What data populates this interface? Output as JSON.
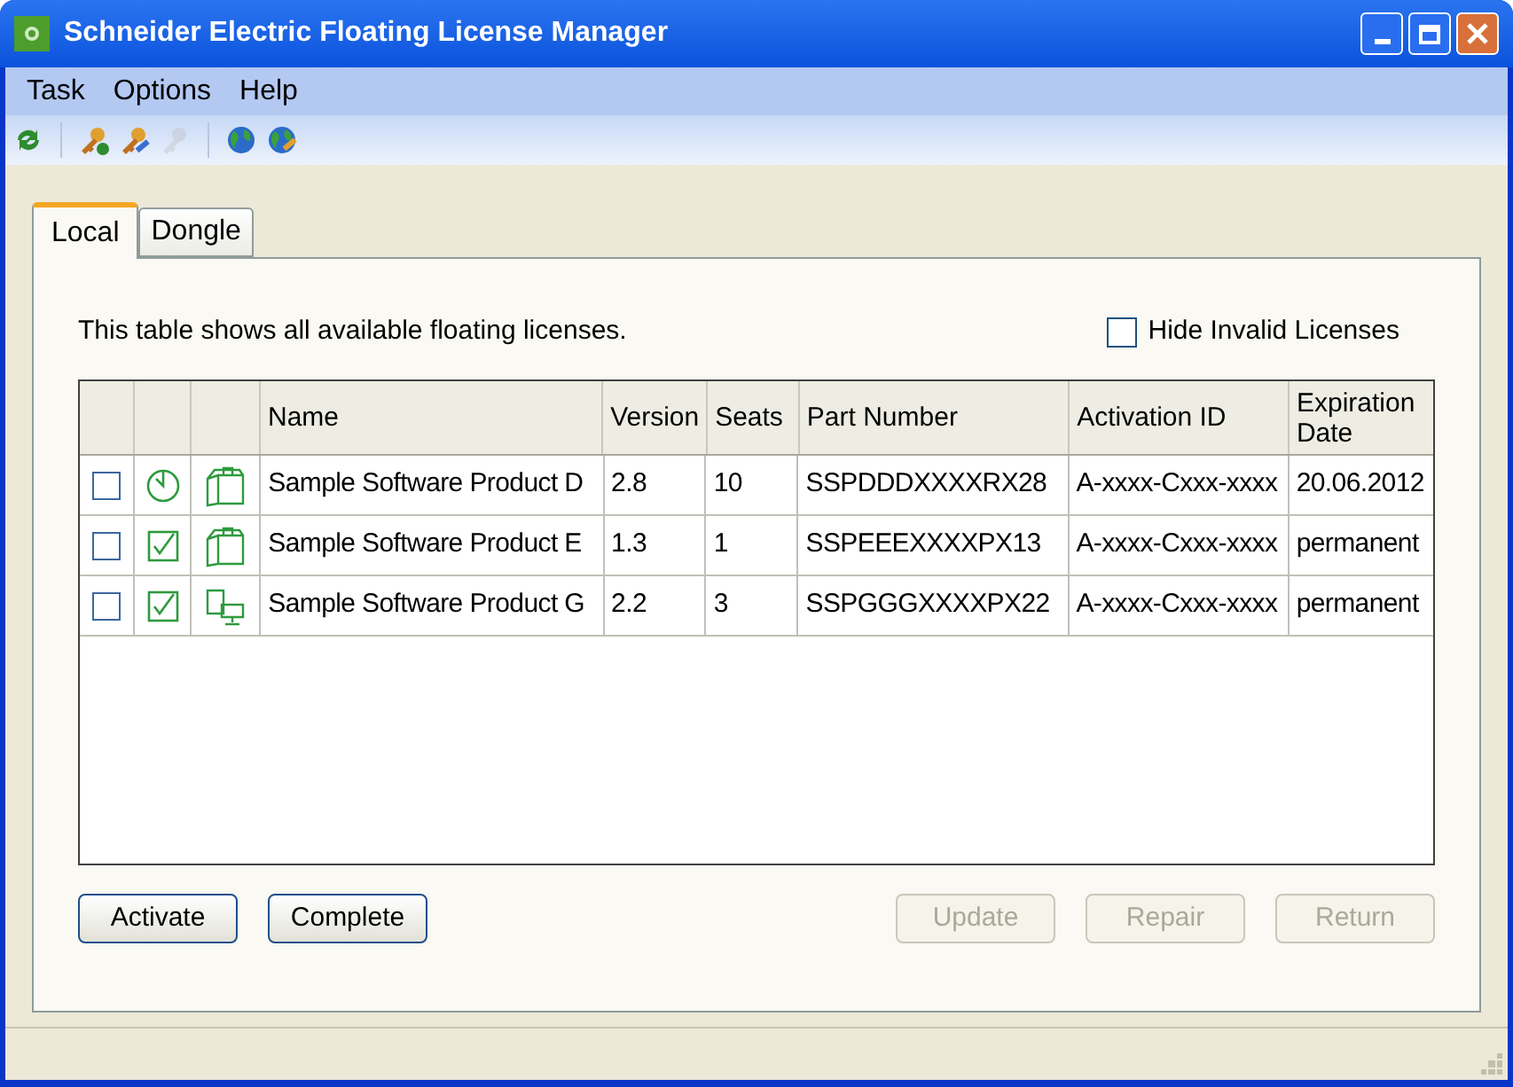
{
  "window": {
    "title": "Schneider Electric Floating License Manager"
  },
  "menu": [
    "Task",
    "Options",
    "Help"
  ],
  "toolbar": [
    {
      "kind": "refresh",
      "disabled": false
    },
    {
      "kind": "sep"
    },
    {
      "kind": "add",
      "disabled": false
    },
    {
      "kind": "edit",
      "disabled": false
    },
    {
      "kind": "remove",
      "disabled": true
    },
    {
      "kind": "sep"
    },
    {
      "kind": "globe",
      "disabled": false
    },
    {
      "kind": "globe-edit",
      "disabled": false
    }
  ],
  "tabs": [
    {
      "label": "Local",
      "selected": true
    },
    {
      "label": "Dongle",
      "selected": false
    }
  ],
  "description": "This table shows all available floating licenses.",
  "hide_invalid": {
    "label": "Hide Invalid Licenses",
    "checked": false
  },
  "table": {
    "columns": [
      "Name",
      "Version",
      "Seats",
      "Part Number",
      "Activation ID",
      "Expiration Date"
    ],
    "rows": [
      {
        "checked": false,
        "status": {
          "kind": "clock"
        },
        "type": {
          "kind": "box"
        },
        "name": "Sample Software Product D",
        "version": "2.8",
        "seats": "10",
        "part_number": "SSPDDDXXXXRX28",
        "activation_id": "A-xxxx-Cxxx-xxxx",
        "expiration": "20.06.2012"
      },
      {
        "checked": false,
        "status": {
          "kind": "check"
        },
        "type": {
          "kind": "box"
        },
        "name": "Sample Software Product E",
        "version": "1.3",
        "seats": "1",
        "part_number": "SSPEEEXXXXPX13",
        "activation_id": "A-xxxx-Cxxx-xxxx",
        "expiration": "permanent"
      },
      {
        "checked": false,
        "status": {
          "kind": "check"
        },
        "type": {
          "kind": "computer"
        },
        "name": "Sample Software Product G",
        "version": "2.2",
        "seats": "3",
        "part_number": "SSPGGGXXXXPX22",
        "activation_id": "A-xxxx-Cxxx-xxxx",
        "expiration": "permanent"
      }
    ]
  },
  "buttons_left": [
    {
      "label": "Activate",
      "disabled": false
    },
    {
      "label": "Complete",
      "disabled": false
    }
  ],
  "buttons_right": [
    {
      "label": "Update",
      "disabled": true
    },
    {
      "label": "Repair",
      "disabled": true
    },
    {
      "label": "Return",
      "disabled": true
    }
  ]
}
